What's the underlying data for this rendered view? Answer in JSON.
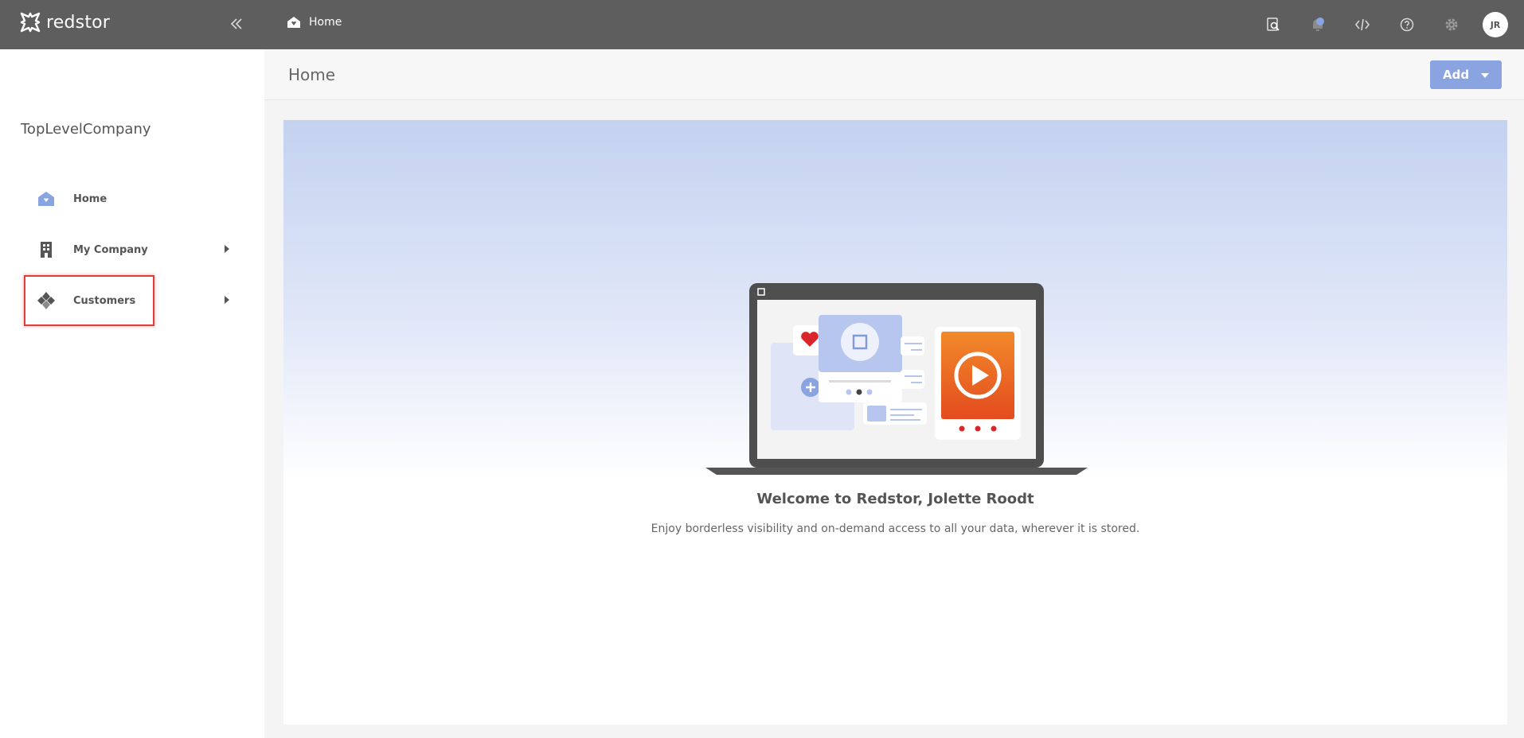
{
  "app": {
    "logo_text": "redstor"
  },
  "topbar": {
    "breadcrumb": "Home",
    "user_initials": "JR"
  },
  "sidebar": {
    "company_name": "TopLevelCompany",
    "items": [
      {
        "label": "Home",
        "icon": "house-icon",
        "has_children": false
      },
      {
        "label": "My Company",
        "icon": "building-icon",
        "has_children": true
      },
      {
        "label": "Customers",
        "icon": "customers-icon",
        "has_children": true
      }
    ]
  },
  "page": {
    "title": "Home",
    "add_label": "Add"
  },
  "welcome": {
    "heading": "Welcome to Redstor, Jolette Roodt",
    "subtext": "Enjoy borderless visibility and on-demand access to all your data, wherever it is stored."
  },
  "colors": {
    "topbar": "#5e5e5e",
    "accent": "#8aa4e2",
    "highlight": "#e23d3d",
    "play_orange": "#f28a2a"
  }
}
